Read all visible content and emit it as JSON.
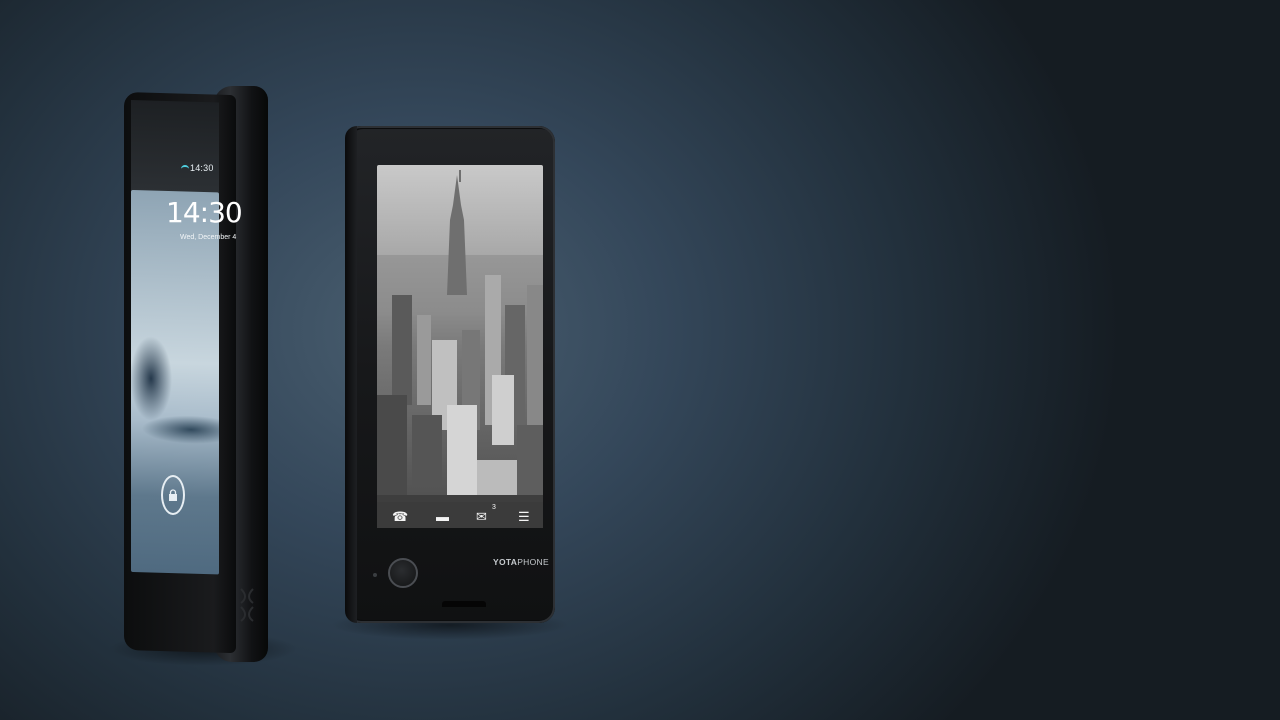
{
  "phone_front": {
    "status_time": "14:30",
    "lock_clock": "14:30",
    "lock_date": "Wed, December 4"
  },
  "phone_back": {
    "brand_bold": "YOTA",
    "brand_light": "PHONE",
    "mail_count": "3",
    "icons": [
      "phone-icon",
      "chat-icon",
      "mail-icon",
      "menu-icon"
    ]
  },
  "colors": {
    "background": "#2f4050",
    "phone_body": "#141516",
    "lcd_accent": "#4fd0e0"
  }
}
